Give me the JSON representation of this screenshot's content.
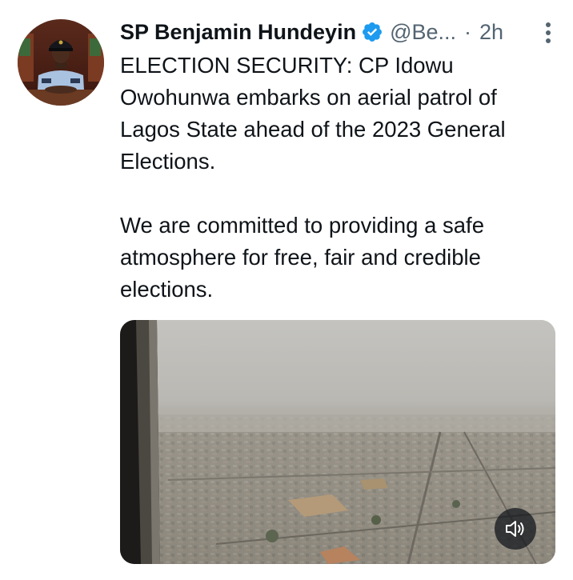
{
  "tweet": {
    "author_name": "SP Benjamin Hundeyin",
    "handle": "@Be...",
    "separator": "·",
    "time": "2h",
    "text": "ELECTION SECURITY: CP Idowu Owohunwa embarks on aerial patrol of Lagos State ahead of the 2023 General Elections.\n\nWe are committed to providing a safe atmosphere for free, fair and credible elections."
  },
  "icons": {
    "verified": "verified-badge-icon",
    "more": "more-options-icon",
    "sound": "speaker-muted-icon"
  },
  "colors": {
    "verified": "#1d9bf0",
    "secondary_text": "#536471",
    "primary_text": "#0f1419"
  }
}
